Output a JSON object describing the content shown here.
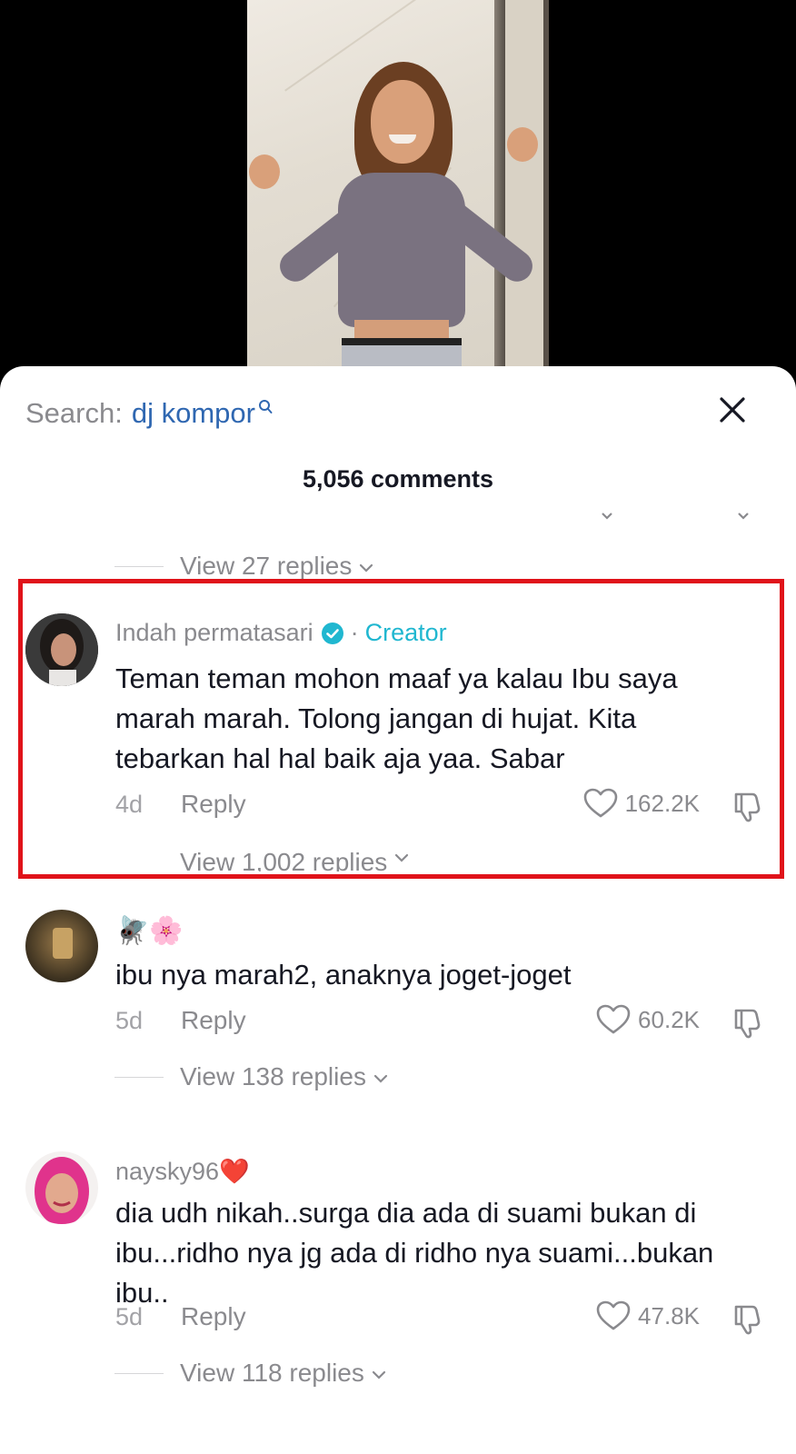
{
  "search": {
    "prefix": "Search:",
    "term": "dj kompor"
  },
  "comments_count": "5,056 comments",
  "top_replies": "View 27 replies",
  "comments": [
    {
      "username": "Indah permatasari",
      "badge": "Creator",
      "text": "Teman teman mohon maaf ya kalau Ibu saya marah marah. Tolong jangan di hujat. Kita tebarkan hal hal baik aja yaa. Sabar",
      "time": "4d",
      "reply_label": "Reply",
      "likes": "162.2K",
      "replies": "View 1,002 replies"
    },
    {
      "username": "🪰🌸",
      "text": "ibu nya marah2, anaknya joget-joget",
      "time": "5d",
      "reply_label": "Reply",
      "likes": "60.2K",
      "replies": "View 138 replies"
    },
    {
      "username": "naysky96❤️",
      "text": "dia udh nikah..surga dia ada di suami bukan di ibu...ridho nya jg ada di ridho nya suami...bukan ibu..",
      "time": "5d",
      "reply_label": "Reply",
      "likes": "47.8K",
      "replies": "View 118 replies"
    }
  ],
  "colors": {
    "accent_link": "#2f67b1",
    "creator": "#20b7d0",
    "highlight": "#e0131a"
  },
  "icons": [
    "search-icon",
    "close-icon",
    "verified-icon",
    "heart-icon",
    "dislike-icon",
    "chevron-down-icon"
  ]
}
